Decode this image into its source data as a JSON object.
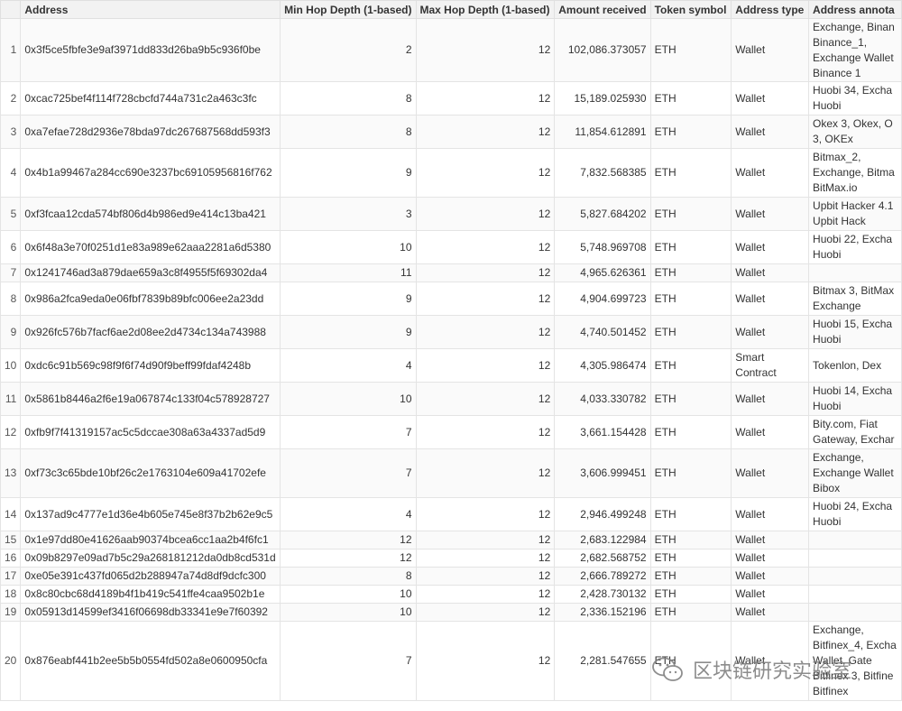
{
  "table": {
    "headers": [
      "",
      "Address",
      "Min Hop Depth (1-based)",
      "Max Hop Depth (1-based)",
      "Amount received",
      "Token symbol",
      "Address type",
      "Address annota"
    ],
    "rows": [
      {
        "idx": "1",
        "address": "0x3f5ce5fbfe3e9af3971dd833d26ba9b5c936f0be",
        "min": "2",
        "max": "12",
        "amount": "102,086.373057",
        "token": "ETH",
        "type": "Wallet",
        "annotation": "Exchange, Binan Binance_1, Exchange Wallet Binance 1",
        "h": 70
      },
      {
        "idx": "2",
        "address": "0xcac725bef4f114f728cbcfd744a731c2a463c3fc",
        "min": "8",
        "max": "12",
        "amount": "15,189.025930",
        "token": "ETH",
        "type": "Wallet",
        "annotation": "Huobi 34, Excha Huobi",
        "h": 37
      },
      {
        "idx": "3",
        "address": "0xa7efae728d2936e78bda97dc267687568dd593f3",
        "min": "8",
        "max": "12",
        "amount": "11,854.612891",
        "token": "ETH",
        "type": "Wallet",
        "annotation": "Okex 3, Okex, O 3, OKEx",
        "h": 37
      },
      {
        "idx": "4",
        "address": "0x4b1a99467a284cc690e3237bc69105956816f762",
        "min": "9",
        "max": "12",
        "amount": "7,832.568385",
        "token": "ETH",
        "type": "Wallet",
        "annotation": "Bitmax_2, Exchange, Bitma BitMax.io",
        "h": 54
      },
      {
        "idx": "5",
        "address": "0xf3fcaa12cda574bf806d4b986ed9e414c13ba421",
        "min": "3",
        "max": "12",
        "amount": "5,827.684202",
        "token": "ETH",
        "type": "Wallet",
        "annotation": "Upbit Hacker 4.1 Upbit Hack",
        "h": 37
      },
      {
        "idx": "6",
        "address": "0x6f48a3e70f0251d1e83a989e62aaa2281a6d5380",
        "min": "10",
        "max": "12",
        "amount": "5,748.969708",
        "token": "ETH",
        "type": "Wallet",
        "annotation": "Huobi 22, Excha Huobi",
        "h": 37
      },
      {
        "idx": "7",
        "address": "0x1241746ad3a879dae659a3c8f4955f5f69302da4",
        "min": "11",
        "max": "12",
        "amount": "4,965.626361",
        "token": "ETH",
        "type": "Wallet",
        "annotation": "",
        "h": 20
      },
      {
        "idx": "8",
        "address": "0x986a2fca9eda0e06fbf7839b89bfc006ee2a23dd",
        "min": "9",
        "max": "12",
        "amount": "4,904.699723",
        "token": "ETH",
        "type": "Wallet",
        "annotation": "Bitmax 3, BitMax Exchange",
        "h": 37
      },
      {
        "idx": "9",
        "address": "0x926fc576b7facf6ae2d08ee2d4734c134a743988",
        "min": "9",
        "max": "12",
        "amount": "4,740.501452",
        "token": "ETH",
        "type": "Wallet",
        "annotation": "Huobi 15, Excha Huobi",
        "h": 37
      },
      {
        "idx": "10",
        "address": "0xdc6c91b569c98f9f6f74d90f9beff99fdaf4248b",
        "min": "4",
        "max": "12",
        "amount": "4,305.986474",
        "token": "ETH",
        "type": "Smart Contract",
        "annotation": "Tokenlon, Dex",
        "h": 37
      },
      {
        "idx": "11",
        "address": "0x5861b8446a2f6e19a067874c133f04c578928727",
        "min": "10",
        "max": "12",
        "amount": "4,033.330782",
        "token": "ETH",
        "type": "Wallet",
        "annotation": "Huobi 14, Excha Huobi",
        "h": 37
      },
      {
        "idx": "12",
        "address": "0xfb9f7f41319157ac5c5dccae308a63a4337ad5d9",
        "min": "7",
        "max": "12",
        "amount": "3,661.154428",
        "token": "ETH",
        "type": "Wallet",
        "annotation": "Bity.com, Fiat Gateway, Exchar",
        "h": 37
      },
      {
        "idx": "13",
        "address": "0xf73c3c65bde10bf26c2e1763104e609a41702efe",
        "min": "7",
        "max": "12",
        "amount": "3,606.999451",
        "token": "ETH",
        "type": "Wallet",
        "annotation": "Exchange, Exchange Wallet Bibox",
        "h": 54
      },
      {
        "idx": "14",
        "address": "0x137ad9c4777e1d36e4b605e745e8f37b2b62e9c5",
        "min": "4",
        "max": "12",
        "amount": "2,946.499248",
        "token": "ETH",
        "type": "Wallet",
        "annotation": "Huobi 24, Excha Huobi",
        "h": 37
      },
      {
        "idx": "15",
        "address": "0x1e97dd80e41626aab90374bcea6cc1aa2b4f6fc1",
        "min": "12",
        "max": "12",
        "amount": "2,683.122984",
        "token": "ETH",
        "type": "Wallet",
        "annotation": "",
        "h": 20
      },
      {
        "idx": "16",
        "address": "0x09b8297e09ad7b5c29a268181212da0db8cd531d",
        "min": "12",
        "max": "12",
        "amount": "2,682.568752",
        "token": "ETH",
        "type": "Wallet",
        "annotation": "",
        "h": 20
      },
      {
        "idx": "17",
        "address": "0xe05e391c437fd065d2b288947a74d8df9dcfc300",
        "min": "8",
        "max": "12",
        "amount": "2,666.789272",
        "token": "ETH",
        "type": "Wallet",
        "annotation": "",
        "h": 20
      },
      {
        "idx": "18",
        "address": "0x8c80cbc68d4189b4f1b419c541ffe4caa9502b1e",
        "min": "10",
        "max": "12",
        "amount": "2,428.730132",
        "token": "ETH",
        "type": "Wallet",
        "annotation": "",
        "h": 20
      },
      {
        "idx": "19",
        "address": "0x05913d14599ef3416f06698db33341e9e7f60392",
        "min": "10",
        "max": "12",
        "amount": "2,336.152196",
        "token": "ETH",
        "type": "Wallet",
        "annotation": "",
        "h": 20
      },
      {
        "idx": "20",
        "address": "0x876eabf441b2ee5b5b0554fd502a8e0600950cfa",
        "min": "7",
        "max": "12",
        "amount": "2,281.547655",
        "token": "ETH",
        "type": "Wallet",
        "annotation": "Exchange, Bitfinex_4, Excha Wallet, Gate Bitfinex 3, Bitfine Bitfinex",
        "h": 88
      }
    ]
  },
  "watermark": {
    "text": "区块链研究实验室",
    "icon": "wechat-icon"
  }
}
